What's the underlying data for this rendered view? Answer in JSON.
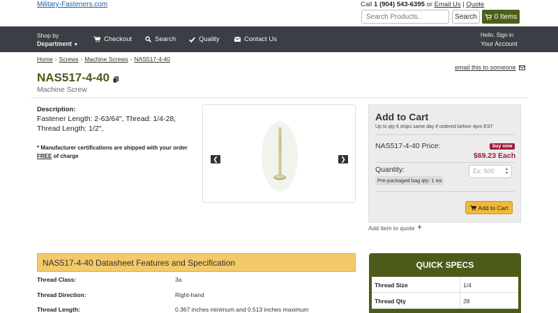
{
  "header": {
    "logo": "Military-Fasteners.com",
    "call_prefix": "Call",
    "phone": "1 (904) 543-6395",
    "or_text": "or",
    "email_us": "Email Us",
    "pipe": "|",
    "quote": "Quote",
    "search_placeholder": "Search Products..",
    "search_button": "Search",
    "cart_label": "0 Items"
  },
  "nav": {
    "shop_by": "Shop by",
    "department": "Department",
    "items": [
      {
        "label": "Checkout",
        "icon": "cart-icon"
      },
      {
        "label": "Search",
        "icon": "search-icon"
      },
      {
        "label": "Quality",
        "icon": "check-icon"
      },
      {
        "label": "Contact Us",
        "icon": "envelope-icon"
      }
    ],
    "hello": "Hello. Sign in",
    "account": "Your Account"
  },
  "breadcrumb": [
    "Home",
    "Screws",
    "Machine Screws",
    "NAS517-4-40"
  ],
  "product": {
    "title": "NAS517-4-40",
    "subtitle": "Machine Screw",
    "email_link": "email this to someone",
    "description_heading": "Description:",
    "description": "Fastener Length: 2-63/64\", Thread: 1/4-28, Thread Length: 1/2\",",
    "note_prefix": "* Manufacturer certifications are shipped with your order",
    "note_free": "FREE",
    "note_suffix": "of charge"
  },
  "cart": {
    "title": "Add to Cart",
    "subtitle": "Up to qty 6 ships same day if ordered before 4pm EST",
    "price_label": "NAS517-4-40 Price:",
    "buy_now": "buy now",
    "price": "$69.23 Each",
    "quantity_label": "Quantity:",
    "quantity_placeholder": "Ex: 500",
    "bag_qty": "Pre-packaged bag qty: 1 ea",
    "add_button": "Add to Cart",
    "add_quote": "Add item to quote"
  },
  "datasheet": {
    "heading": "NAS517-4-40 Datasheet Features and Specification",
    "rows": [
      {
        "key": "Thread Class:",
        "value": "3a"
      },
      {
        "key": "Thread Direction:",
        "value": "Right-hand"
      },
      {
        "key": "Thread Length:",
        "value": "0.367 inches minimum and 0.513 inches maximum"
      }
    ]
  },
  "quick_specs": {
    "title": "QUICK SPECS",
    "rows": [
      {
        "key": "Thread Size",
        "value": "1/4"
      },
      {
        "key": "Thread Qty",
        "value": "28"
      }
    ]
  },
  "colors": {
    "brand_green": "#4c6018",
    "price_red": "#9c1b3c",
    "nav_bg": "#3b3f45",
    "datasheet_header": "#f3c969",
    "cart_button": "#f0b93a"
  }
}
